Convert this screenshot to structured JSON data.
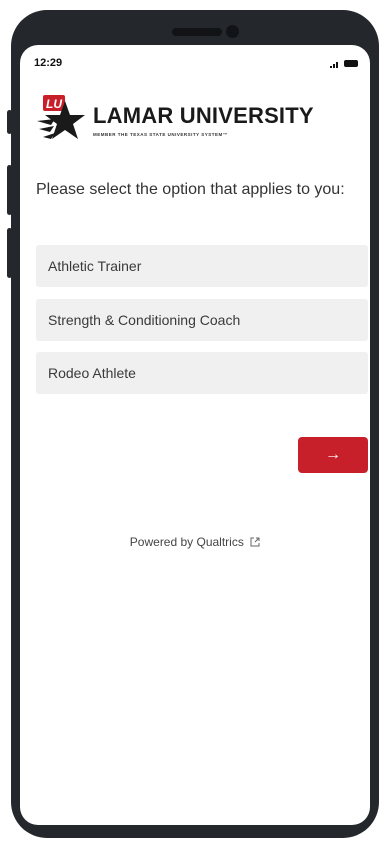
{
  "status_bar": {
    "time": "12:29",
    "icons": [
      "signal-icon",
      "battery-icon"
    ]
  },
  "logo": {
    "title": "LAMAR UNIVERSITY",
    "subtitle": "MEMBER THE TEXAS STATE UNIVERSITY SYSTEM™",
    "mark_letters": "LU",
    "colors": {
      "red": "#c8202b",
      "dark": "#1a1a1a"
    }
  },
  "question": {
    "text": "Please select the option that applies to you:"
  },
  "options": [
    {
      "label": "Athletic Trainer"
    },
    {
      "label": "Strength & Conditioning Coach"
    },
    {
      "label": "Rodeo Athlete"
    }
  ],
  "next_button": {
    "label": "→",
    "color": "#c8202b"
  },
  "footer": {
    "powered_by": "Powered by Qualtrics",
    "icon": "external-link-icon"
  }
}
